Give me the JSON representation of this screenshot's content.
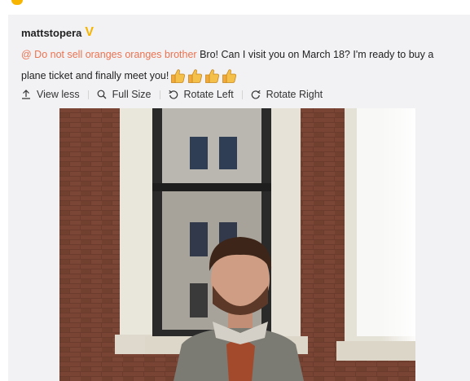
{
  "post": {
    "username": "mattstopera",
    "verified_badge": "V",
    "mention": "@ Do not sell oranges oranges brother",
    "message": " Bro! Can I visit you on March 18? I'm ready to buy a plane ticket and finally meet you!",
    "emoji_count": 4,
    "emoji": "thumbs-up-icon"
  },
  "toolbar": {
    "view_less": "View less",
    "full_size": "Full Size",
    "rotate_left": "Rotate Left",
    "rotate_right": "Rotate Right"
  },
  "colors": {
    "mention": "#eb7350",
    "badge": "#f7b500",
    "card_bg": "#f2f2f5"
  }
}
